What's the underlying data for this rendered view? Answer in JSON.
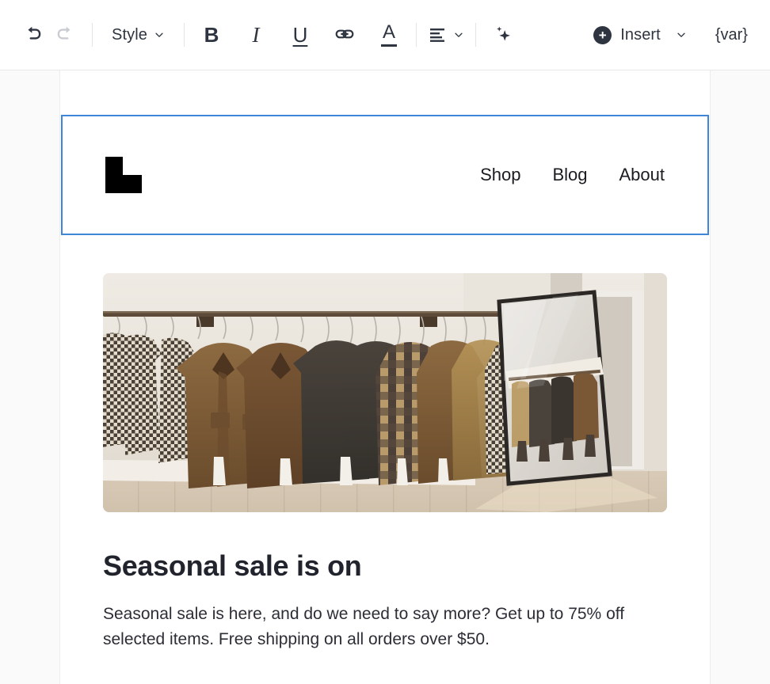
{
  "toolbar": {
    "undo": {
      "label": "undo-arrow",
      "enabled": true
    },
    "redo": {
      "label": "redo-arrow",
      "enabled": false
    },
    "style_label": "Style",
    "bold_label": "B",
    "italic_label": "I",
    "underline_label": "U",
    "link_label": "link",
    "text_color_label": "A",
    "align_label": "align",
    "ai_label": "sparkle",
    "insert_label": "Insert",
    "insert_plus": "+",
    "variable_label": "{var}",
    "chevron": "⌄"
  },
  "email": {
    "header": {
      "selected": true,
      "logo_alt": "L-shaped brand mark",
      "nav": [
        {
          "label": "Shop"
        },
        {
          "label": "Blog"
        },
        {
          "label": "About"
        }
      ]
    },
    "hero": {
      "alt": "Clothing rack with brown jackets and checked flannel shirts beside a leaning floor mirror"
    },
    "headline": "Seasonal sale is on",
    "body": "Seasonal sale is here, and do we need to say more? Get up to 75% off selected items. Free shipping on all orders over $50."
  },
  "colors": {
    "selection_blue": "#3f85d8",
    "toolbar_icon": "#2e3440",
    "disabled_icon": "#c9ccd2",
    "canvas_bg": "#fafafa",
    "heading": "#22242d"
  }
}
